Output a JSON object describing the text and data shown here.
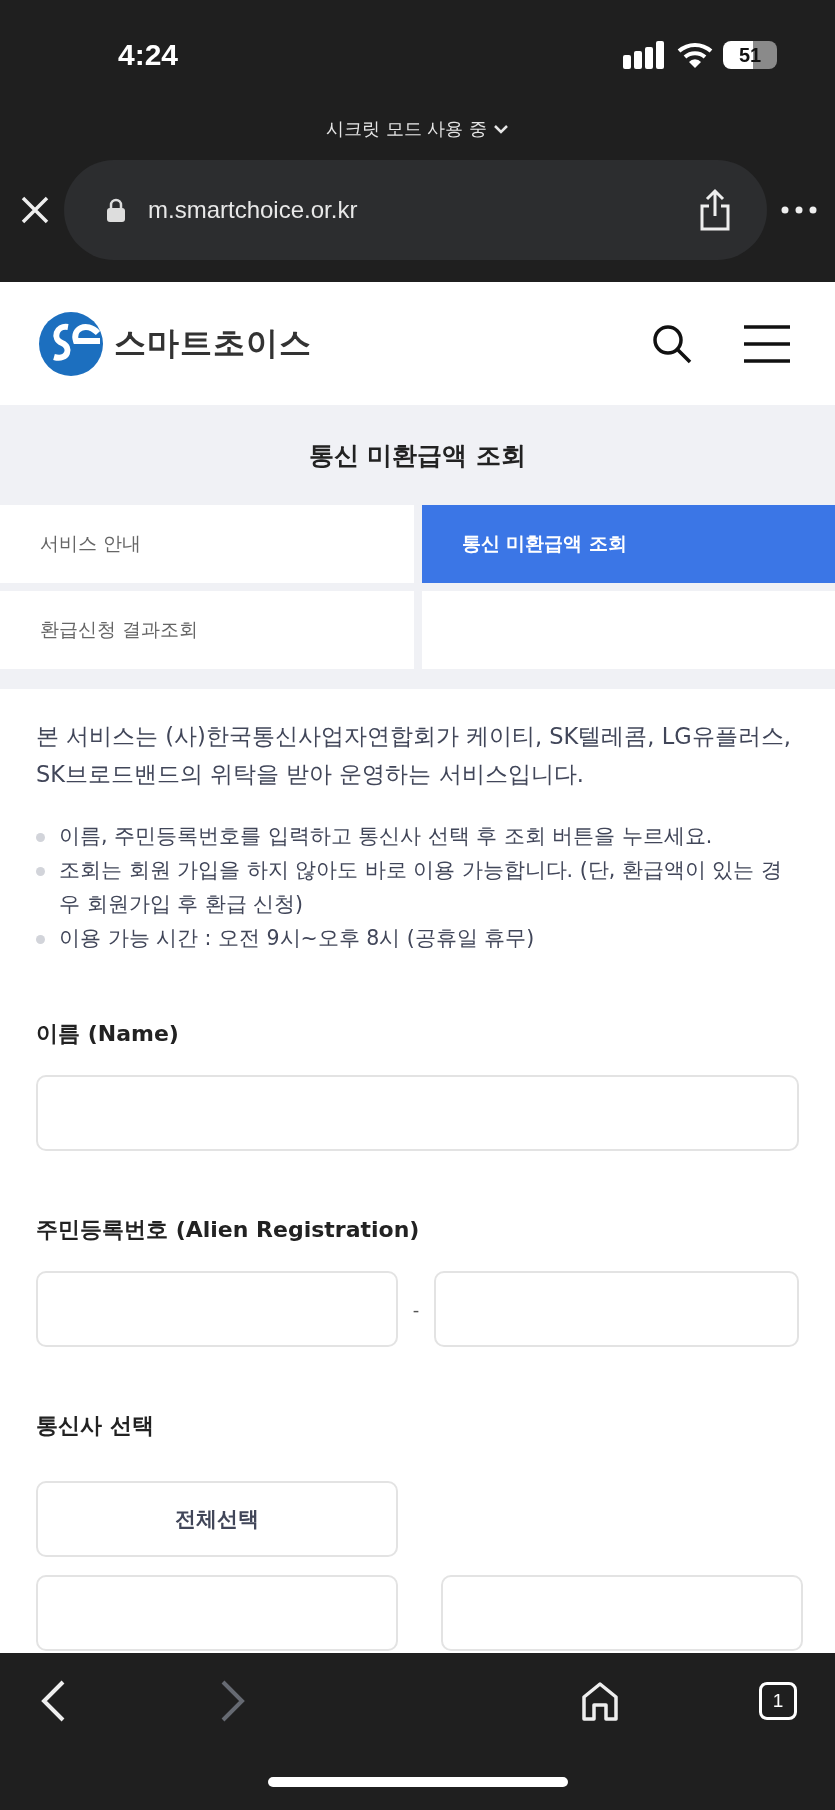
{
  "status_bar": {
    "time": "4:24",
    "battery": "51"
  },
  "browser": {
    "mode_label": "시크릿 모드 사용 중",
    "url": "m.smartchoice.or.kr"
  },
  "site_header": {
    "brand": "스마트초이스"
  },
  "page_title": "통신 미환급액 조회",
  "tabs": [
    {
      "label": "서비스 안내",
      "selected": false
    },
    {
      "label": "통신 미환급액 조회",
      "selected": true
    },
    {
      "label": "환급신청 결과조회",
      "selected": false
    }
  ],
  "intro": "본 서비스는 (사)한국통신사업자연합회가 케이티, SK텔레콤, LG유플러스, SK브로드밴드의 위탁을 받아 운영하는 서비스입니다.",
  "notes": [
    "이름, 주민등록번호를 입력하고 통신사 선택 후 조회 버튼을 누르세요.",
    "조회는 회원 가입을 하지 않아도 바로 이용 가능합니다. (단, 환급액이 있는 경우 회원가입 후 환급 신청)",
    "이용 가능 시간 : 오전 9시~오후 8시 (공휴일 휴무)"
  ],
  "form": {
    "name_label": "이름 (Name)",
    "id_label": "주민등록번호 (Alien Registration)",
    "id_separator": "-",
    "carrier_label": "통신사 선택",
    "select_all": "전체선택"
  },
  "bottom_bar": {
    "tab_count": "1"
  }
}
